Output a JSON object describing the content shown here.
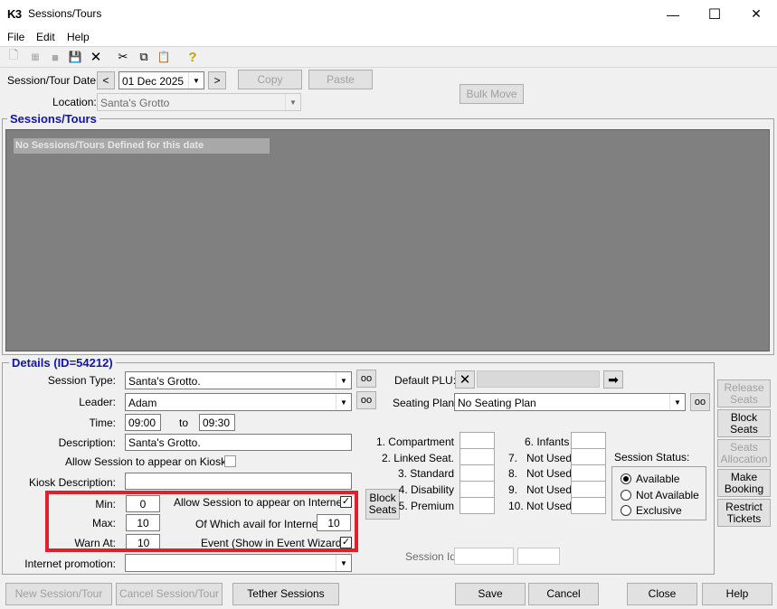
{
  "window": {
    "logo": "K3",
    "title": "Sessions/Tours",
    "min_icon": "—",
    "max_icon": "☐",
    "close_icon": "✕"
  },
  "menu": [
    "File",
    "Edit",
    "Help"
  ],
  "toolbar": {
    "new_icon": "🗋",
    "save_icon": "💾",
    "delete_icon": "✕",
    "cut_icon": "✂",
    "copy_icon": "⧉",
    "paste_icon": "📋",
    "help_icon": "?"
  },
  "top": {
    "date_label": "Session/Tour Date:",
    "prev": "<",
    "date": "01 Dec 2025",
    "next": ">",
    "copy": "Copy",
    "paste": "Paste",
    "location_label": "Location:",
    "location": "Santa's Grotto",
    "bulk_move": "Bulk Move"
  },
  "sessions": {
    "title": "Sessions/Tours",
    "empty": "No Sessions/Tours Defined for this date"
  },
  "details": {
    "title": "Details (ID=54212)",
    "session_type_label": "Session Type:",
    "session_type": "Santa's Grotto.",
    "leader_label": "Leader:",
    "leader": "Adam",
    "time_label": "Time:",
    "time_from": "09:00",
    "time_to_label": "to",
    "time_to": "09:30",
    "description_label": "Description:",
    "description": "Santa's Grotto.",
    "kiosk_allow_label": "Allow Session to appear on Kiosk",
    "kiosk_desc_label": "Kiosk Description:",
    "kiosk_desc": "",
    "min_label": "Min:",
    "min": "0",
    "max_label": "Max:",
    "max": "10",
    "warn_label": "Warn At:",
    "warn": "10",
    "internet_allow_label": "Allow Session to appear on Internet",
    "internet_avail_label": "Of Which avail for Internet:",
    "internet_avail": "10",
    "event_label": "Event (Show in Event Wizard)",
    "block_seats": "Block Seats",
    "internet_promo_label": "Internet promotion:",
    "internet_promo": "",
    "default_plu_label": "Default PLU:",
    "seating_plan_label": "Seating Plan:",
    "seating_plan": "No Seating Plan",
    "seat_types_left": [
      "1. Compartment",
      "2. Linked Seat.",
      "3. Standard",
      "4. Disability",
      "5. Premium"
    ],
    "seat_types_right": [
      "6. Infants",
      "7.   Not Used",
      "8.   Not Used",
      "9.   Not Used",
      "10. Not Used"
    ],
    "session_id_label": "Session Id",
    "status_label": "Session Status:",
    "status_options": [
      "Available",
      "Not Available",
      "Exclusive"
    ],
    "release_seats": "Release Seats",
    "block_seats_side": "Block Seats",
    "seats_allocation": "Seats Allocation",
    "make_booking": "Make Booking",
    "restrict_tickets": "Restrict Tickets",
    "check": "✓",
    "glasses_icon": "oo",
    "clear_icon": "✕",
    "arrow_icon": "➡",
    "dropdown_icon": "▼"
  },
  "bottom": {
    "new_session": "New Session/Tour",
    "cancel_session": "Cancel Session/Tour",
    "tether": "Tether Sessions",
    "save": "Save",
    "cancel": "Cancel",
    "close": "Close",
    "help": "Help"
  }
}
